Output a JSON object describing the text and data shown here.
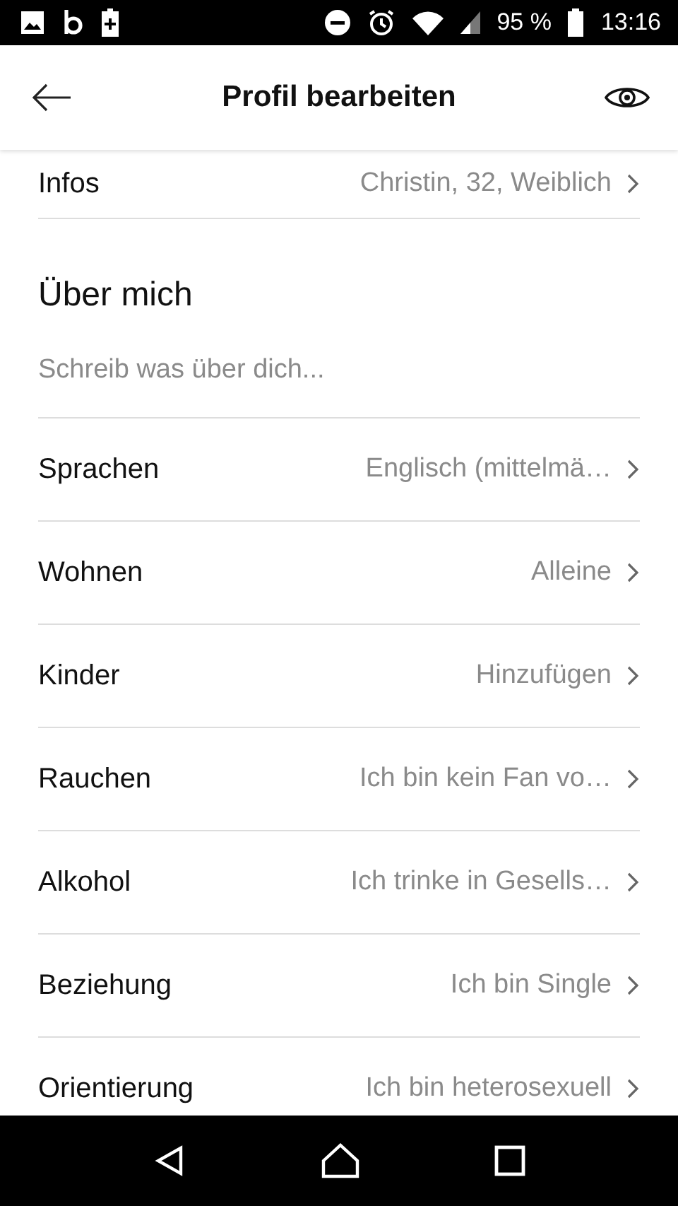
{
  "status_bar": {
    "battery": "95 %",
    "time": "13:16"
  },
  "header": {
    "title": "Profil bearbeiten"
  },
  "infos": {
    "label": "Infos",
    "value": "Christin, 32, Weiblich"
  },
  "about": {
    "heading": "Über mich",
    "placeholder": "Schreib was über dich..."
  },
  "rows": [
    {
      "label": "Sprachen",
      "value": "Englisch (mittelmä…"
    },
    {
      "label": "Wohnen",
      "value": "Alleine"
    },
    {
      "label": "Kinder",
      "value": "Hinzufügen"
    },
    {
      "label": "Rauchen",
      "value": "Ich bin kein Fan vo…"
    },
    {
      "label": "Alkohol",
      "value": "Ich trinke in Gesells…"
    },
    {
      "label": "Beziehung",
      "value": "Ich bin Single"
    },
    {
      "label": "Orientierung",
      "value": "Ich bin heterosexuell"
    }
  ]
}
